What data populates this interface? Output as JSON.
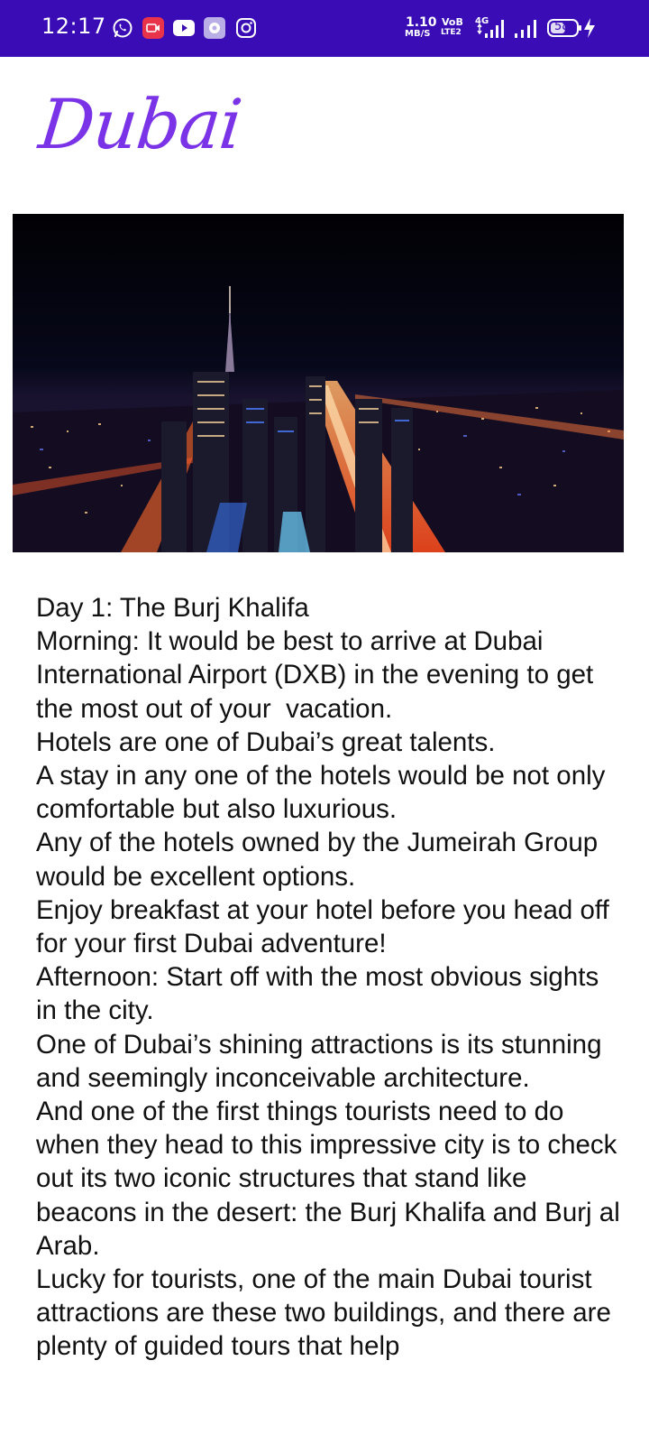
{
  "status_bar": {
    "time": "12:17",
    "left_icons": [
      "whatsapp-icon",
      "screen-recorder-icon",
      "youtube-icon",
      "settings-app-icon",
      "instagram-icon"
    ],
    "network_speed_value": "1.10",
    "network_speed_unit": "MB/S",
    "volte_top": "VoB",
    "volte_bottom": "LTE2",
    "network_type": "4G",
    "battery_level": "58",
    "battery_level_fraction": 0.58,
    "charging": true,
    "bar_color": "#3a0cb6"
  },
  "header": {
    "title": "Dubai",
    "title_color": "#7a33e6"
  },
  "hero": {
    "description_icon": "city-night-skyline-image"
  },
  "article": {
    "paragraphs": [
      "Day 1: The Burj Khalifa",
      "Morning: It would be best to arrive at Dubai International Airport (DXB) in the evening to get the most out of your  vacation.",
      "Hotels are one of Dubai’s great talents.",
      "A stay in any one of the hotels would be not only comfortable but also luxurious.",
      "Any of the hotels owned by the Jumeirah Group would be excellent options.",
      "Enjoy breakfast at your hotel before you head off for your first Dubai adventure!",
      "Afternoon: Start off with the most obvious sights in the city.",
      "One of Dubai’s shining attractions is its stunning and seemingly inconceivable architecture.",
      "And one of the first things tourists need to do when they head to this impressive city is to check out its two iconic structures that stand like beacons in the desert: the Burj Khalifa and Burj al Arab.",
      "Lucky for tourists, one of the main Dubai tourist attractions are these two buildings, and there are plenty of guided tours that help"
    ]
  }
}
